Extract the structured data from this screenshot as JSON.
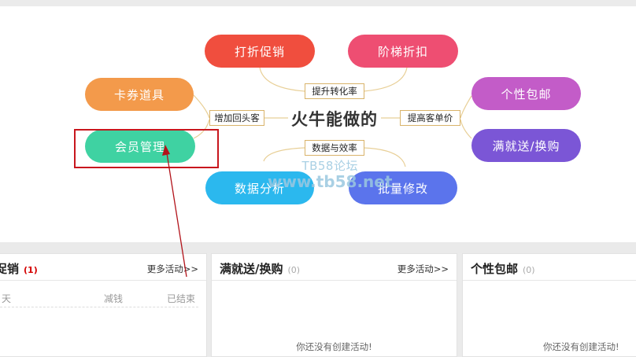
{
  "mindmap": {
    "center": "火牛能做的",
    "connectors": {
      "top": "提升转化率",
      "bottom": "数据与效率",
      "left": "增加回头客",
      "right": "提高客单价"
    },
    "nodes": {
      "discount": "打折促销",
      "tiered_discount": "阶梯折扣",
      "coupons": "卡券道具",
      "member_mgmt": "会员管理",
      "data_analysis": "数据分析",
      "batch_edit": "批量修改",
      "free_shipping": "个性包邮",
      "gift_exchange": "满就送/换购"
    },
    "colors": {
      "discount": "#f04e3e",
      "tiered_discount": "#ee4e72",
      "coupons": "#f39a4b",
      "member_mgmt": "#3fd2a2",
      "data_analysis": "#2bb8ee",
      "batch_edit": "#5b74ec",
      "free_shipping": "#c35cc8",
      "gift_exchange": "#7b56d6"
    }
  },
  "watermark": {
    "line1": "TB58论坛",
    "line2": "www.tb58.net"
  },
  "panels": {
    "left": {
      "title": "促销",
      "count": "(1)",
      "more": "更多活动>>",
      "columns": [
        "天",
        "减钱",
        "已结束"
      ]
    },
    "middle": {
      "title": "满就送/换购",
      "count": "(0)",
      "more": "更多活动>>",
      "empty": "你还没有创建活动!"
    },
    "right": {
      "title": "个性包邮",
      "count": "(0)",
      "empty": "你还没有创建活动!"
    }
  }
}
